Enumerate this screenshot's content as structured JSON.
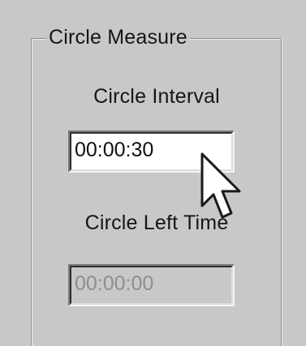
{
  "group": {
    "title": "Circle Measure"
  },
  "interval": {
    "label": "Circle Interval",
    "value": "00:00:30"
  },
  "left_time": {
    "label": "Circle Left Time",
    "value": "00:00:00"
  },
  "icons": {
    "cursor": "mouse-pointer-arrow"
  },
  "colors": {
    "background": "#c8c8c8",
    "field_active_bg": "#ffffff",
    "field_disabled_text": "#8e8e8e"
  }
}
